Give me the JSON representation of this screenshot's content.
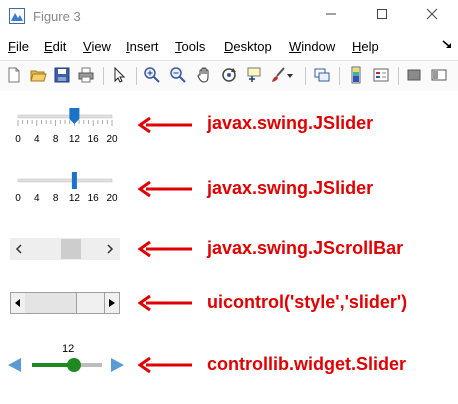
{
  "window": {
    "title": "Figure 3",
    "minimize_icon": "minimize-icon",
    "maximize_icon": "maximize-icon",
    "close_icon": "close-icon"
  },
  "menu": {
    "items": [
      {
        "underline": "F",
        "rest": "ile"
      },
      {
        "underline": "E",
        "rest": "dit"
      },
      {
        "underline": "V",
        "rest": "iew"
      },
      {
        "underline": "I",
        "rest": "nsert"
      },
      {
        "underline": "T",
        "rest": "ools"
      },
      {
        "underline": "D",
        "rest": "esktop"
      },
      {
        "underline": "W",
        "rest": "indow"
      },
      {
        "underline": "H",
        "rest": "elp"
      }
    ]
  },
  "toolbar": {
    "icons": [
      "new-figure-icon",
      "open-file-icon",
      "save-icon",
      "print-icon",
      "pointer-icon",
      "zoom-in-icon",
      "zoom-out-icon",
      "pan-icon",
      "rotate-3d-icon",
      "data-cursor-icon",
      "brush-icon",
      "link-plot-icon",
      "colorbar-icon",
      "legend-icon",
      "hide-plot-tools-icon",
      "show-plot-tools-icon"
    ]
  },
  "slider1": {
    "ticks": [
      "0",
      "4",
      "8",
      "12",
      "16",
      "20"
    ],
    "value": 12,
    "min": 0,
    "max": 20
  },
  "slider2": {
    "ticks": [
      "0",
      "4",
      "8",
      "12",
      "16",
      "20"
    ],
    "value": 12,
    "min": 0,
    "max": 20
  },
  "slider5": {
    "value_label": "12",
    "value": 12,
    "min": 0,
    "max": 20
  },
  "labels": {
    "jslider1": "javax.swing.JSlider",
    "jslider2": "javax.swing.JSlider",
    "jscrollbar": "javax.swing.JScrollBar",
    "uicontrol": "uicontrol('style','slider')",
    "controllib": "controllib.widget.Slider"
  },
  "colors": {
    "arrow_red": "#e00000",
    "thumb_blue": "#1a73c8",
    "controllib_green": "#1f8a1f",
    "controllib_arrow_blue": "#5b9bd5"
  }
}
